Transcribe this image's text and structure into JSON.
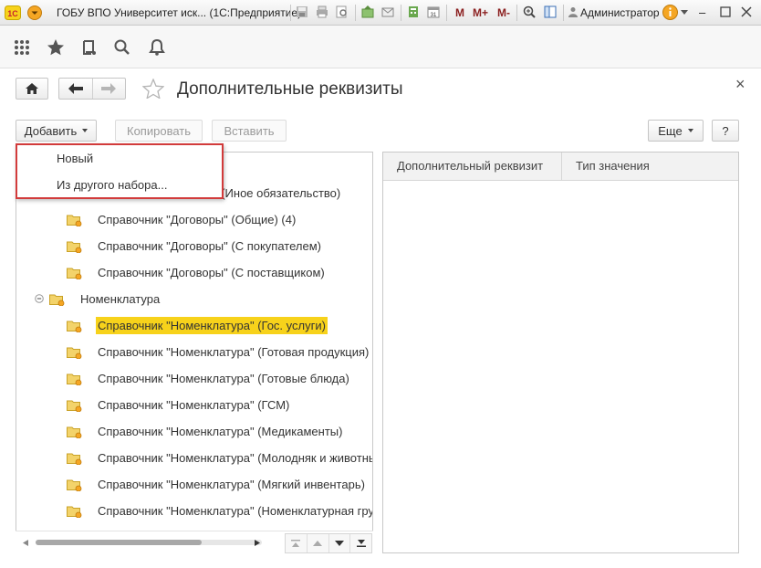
{
  "window": {
    "title": "ГОБУ ВПО Университет иск... (1С:Предприятие)",
    "user": "Администратор",
    "toolbar_letters": [
      "M",
      "M+",
      "M-"
    ]
  },
  "form": {
    "title": "Дополнительные реквизиты",
    "close_glyph": "×"
  },
  "commands": {
    "add": "Добавить",
    "copy": "Копировать",
    "paste": "Вставить",
    "more": "Еще",
    "help": "?"
  },
  "dropdown": {
    "items": [
      "Новый",
      "Из другого набора..."
    ]
  },
  "tree": {
    "partial_row": "\" (Иное обязательство)",
    "rows": [
      {
        "label": "Справочник \"Договоры\" (Общие) (4)",
        "level": 2
      },
      {
        "label": "Справочник \"Договоры\" (С покупателем)",
        "level": 2
      },
      {
        "label": "Справочник \"Договоры\" (С поставщиком)",
        "level": 2
      },
      {
        "label": "Номенклатура",
        "level": 1,
        "expanded": true
      },
      {
        "label": "Справочник \"Номенклатура\" (Гос. услуги)",
        "level": 2,
        "selected": true
      },
      {
        "label": "Справочник \"Номенклатура\" (Готовая продукция)",
        "level": 2
      },
      {
        "label": "Справочник \"Номенклатура\" (Готовые блюда)",
        "level": 2
      },
      {
        "label": "Справочник \"Номенклатура\" (ГСМ)",
        "level": 2
      },
      {
        "label": "Справочник \"Номенклатура\" (Медикаменты)",
        "level": 2
      },
      {
        "label": "Справочник \"Номенклатура\" (Молодняк и животны",
        "level": 2
      },
      {
        "label": "Справочник \"Номенклатура\" (Мягкий инвентарь)",
        "level": 2
      },
      {
        "label": "Справочник \"Номенклатура\" (Номенклатурная груп",
        "level": 2
      }
    ]
  },
  "table": {
    "columns": [
      "Дополнительный реквизит",
      "Тип значения"
    ]
  },
  "colors": {
    "selection": "#f7d21b",
    "highlight_border": "#d23b3b",
    "accent_orange": "#f5a623"
  }
}
